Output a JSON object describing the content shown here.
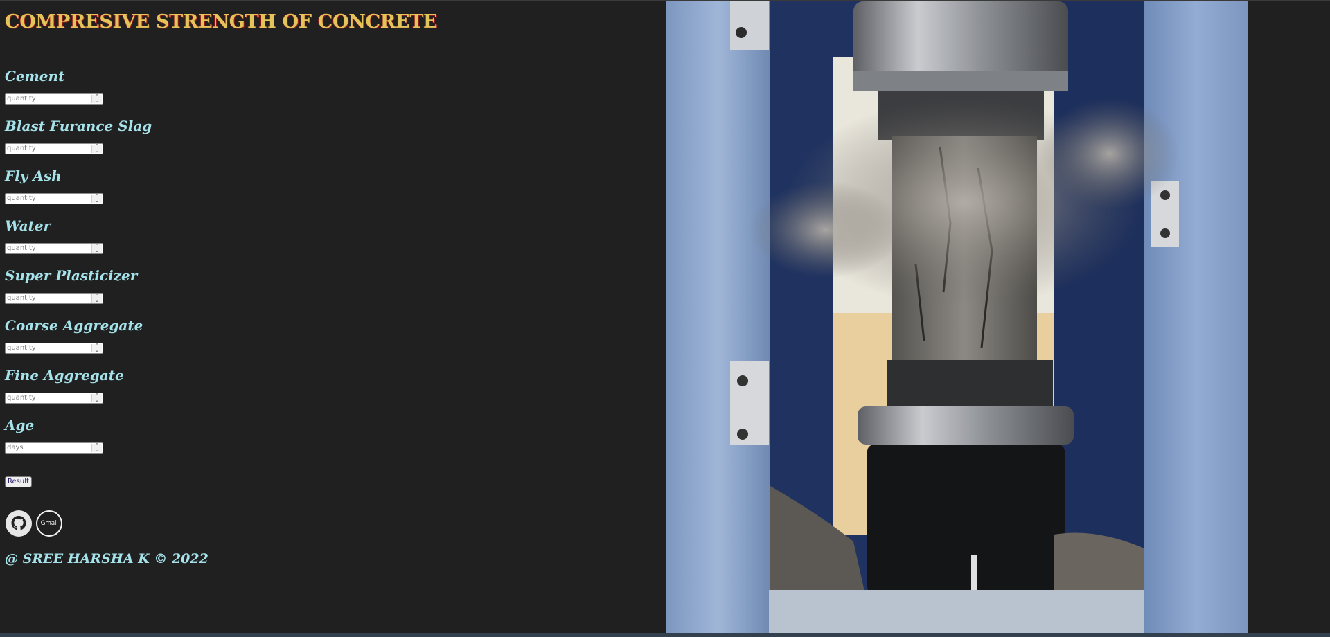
{
  "page": {
    "title": "COMPRESIVE STRENGTH OF CONCRETE"
  },
  "form": {
    "fields": [
      {
        "label": "Cement",
        "placeholder": "quantity"
      },
      {
        "label": "Blast Furance Slag",
        "placeholder": "quantity"
      },
      {
        "label": "Fly Ash",
        "placeholder": "quantity"
      },
      {
        "label": "Water",
        "placeholder": "quantity"
      },
      {
        "label": "Super Plasticizer",
        "placeholder": "quantity"
      },
      {
        "label": "Coarse Aggregate",
        "placeholder": "quantity"
      },
      {
        "label": "Fine Aggregate",
        "placeholder": "quantity"
      },
      {
        "label": "Age",
        "placeholder": "days"
      }
    ],
    "submit_label": "Result"
  },
  "social": {
    "github_icon": "github-icon",
    "gmail_icon": "gmail-icon",
    "gmail_text": "Gmail"
  },
  "footer": {
    "text": "@ SREE HARSHA K © 2022"
  },
  "colors": {
    "background": "#202020",
    "title": "#e3c45a",
    "title_shadow": "#9b1c1c",
    "label": "#a6e2ea"
  }
}
